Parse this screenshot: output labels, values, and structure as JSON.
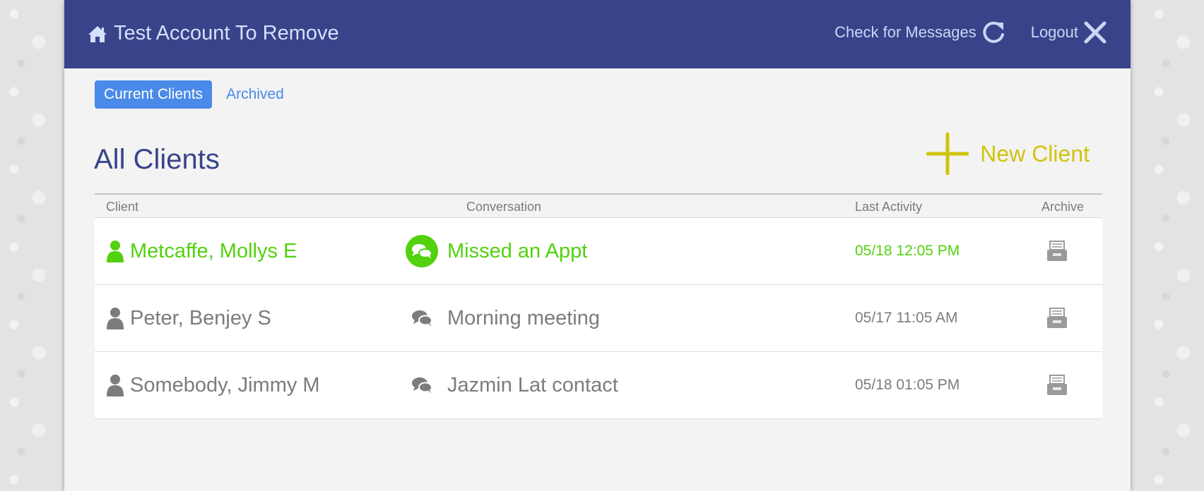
{
  "header": {
    "title": "Test Account To Remove",
    "check_messages_label": "Check for Messages",
    "logout_label": "Logout",
    "background_color": "#39438a",
    "icons": {
      "home": "home-icon",
      "refresh": "refresh-icon",
      "close": "close-icon"
    }
  },
  "tabs": [
    {
      "label": "Current Clients",
      "active": true
    },
    {
      "label": "Archived",
      "active": false
    }
  ],
  "page_title": "All Clients",
  "new_client_label": "New Client",
  "table": {
    "columns": [
      "Client",
      "Conversation",
      "Last Activity",
      "Archive"
    ],
    "rows": [
      {
        "client": "Metcaffe, Mollys E",
        "conversation": "Missed an Appt",
        "last_activity": "05/18 12:05 PM",
        "unread": true
      },
      {
        "client": "Peter, Benjey S",
        "conversation": "Morning meeting",
        "last_activity": "05/17 11:05 AM",
        "unread": false
      },
      {
        "client": "Somebody, Jimmy M",
        "conversation": "Jazmin Lat contact",
        "last_activity": "05/18 01:05 PM",
        "unread": false
      }
    ]
  },
  "colors": {
    "accent_blue": "#4a8ae8",
    "unread_green": "#52d10f",
    "read_gray": "#7c7c7c",
    "new_client_yellow": "#d1c30c"
  }
}
